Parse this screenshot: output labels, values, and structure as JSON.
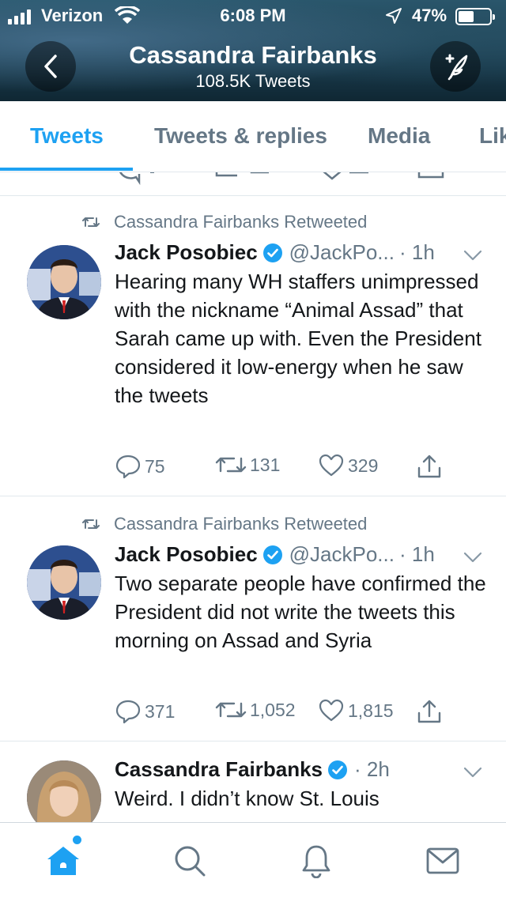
{
  "status_bar": {
    "carrier": "Verizon",
    "time": "6:08 PM",
    "battery": "47%",
    "battery_level": 0.47,
    "icons": [
      "signal-icon",
      "wifi-icon",
      "location-arrow-icon",
      "battery-icon"
    ]
  },
  "header": {
    "name": "Cassandra Fairbanks",
    "tweet_count": "108.5K Tweets",
    "back_icon": "chevron-left-icon",
    "compose_icon": "compose-feather-icon"
  },
  "tabs": [
    {
      "label": "Tweets",
      "active": true
    },
    {
      "label": "Tweets & replies",
      "active": false
    },
    {
      "label": "Media",
      "active": false
    },
    {
      "label": "Lik",
      "active": false
    }
  ],
  "tweets": [
    {
      "retweet_label": "Cassandra Fairbanks Retweeted",
      "author": "Jack Posobiec",
      "handle": "@JackPo...",
      "time": "· 1h",
      "text": "Hearing many WH staffers unimpressed with the nickname “Animal Assad” that Sarah came up with. Even the President considered it low-energy when he saw the tweets",
      "replies": "75",
      "retweets": "131",
      "likes": "329"
    },
    {
      "retweet_label": "Cassandra Fairbanks Retweeted",
      "author": "Jack Posobiec",
      "handle": "@JackPo...",
      "time": "· 1h",
      "text": "Two separate people have confirmed the President did not write the tweets this morning on Assad and Syria",
      "replies": "371",
      "retweets": "1,052",
      "likes": "1,815"
    },
    {
      "author": "Cassandra Fairbanks",
      "time": "· 2h",
      "text": "Weird. I didn’t know St. Louis"
    }
  ],
  "bottom_nav": [
    {
      "name": "home",
      "icon": "home-icon",
      "active": true
    },
    {
      "name": "search",
      "icon": "search-icon",
      "active": false
    },
    {
      "name": "notifications",
      "icon": "bell-icon",
      "active": false
    },
    {
      "name": "messages",
      "icon": "mail-icon",
      "active": false
    }
  ],
  "colors": {
    "accent": "#1da1f2",
    "secondary_text": "#657786",
    "primary_text": "#14171a",
    "divider": "#e1e8ed"
  }
}
